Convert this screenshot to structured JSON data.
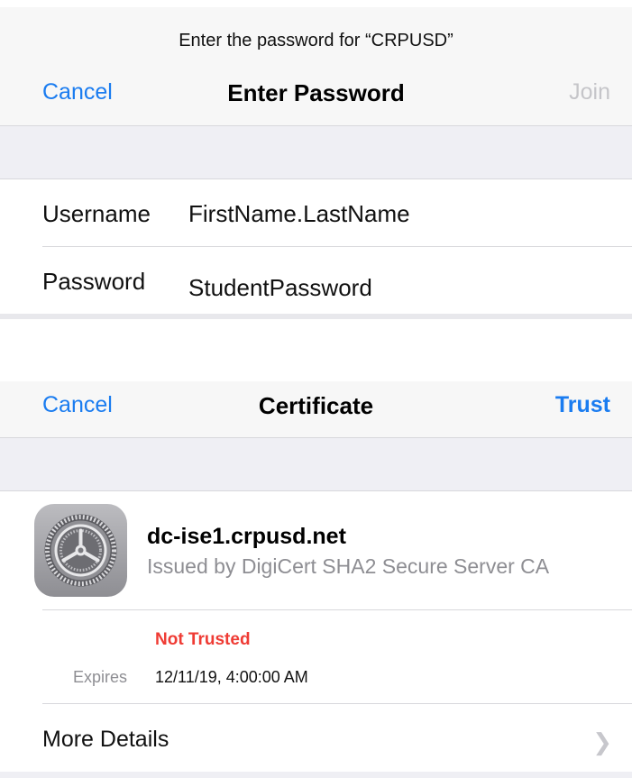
{
  "password_sheet": {
    "prompt": "Enter the password for “CRPUSD”",
    "cancel_label": "Cancel",
    "title": "Enter Password",
    "join_label": "Join",
    "username_label": "Username",
    "username_value": "FirstName.LastName",
    "password_label": "Password",
    "password_value": "StudentPassword"
  },
  "certificate_sheet": {
    "cancel_label": "Cancel",
    "title": "Certificate",
    "trust_label": "Trust",
    "icon": "settings-gear-icon",
    "cert_name": "dc-ise1.crpusd.net",
    "issued_by": "Issued by DigiCert SHA2 Secure Server CA",
    "status": "Not Trusted",
    "expires_label": "Expires",
    "expires_value": "12/11/19, 4:00:00 AM",
    "more_details_label": "More Details"
  },
  "colors": {
    "accent": "#1a7cf0",
    "disabled": "#c5c5c9",
    "danger": "#ef3b34",
    "secondary_text": "#8e8e93"
  }
}
